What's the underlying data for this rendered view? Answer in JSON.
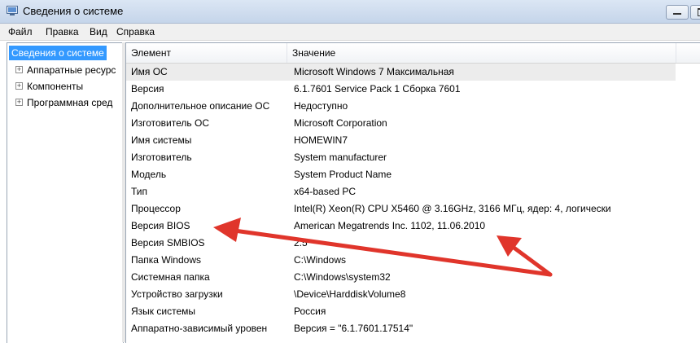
{
  "window": {
    "title": "Сведения о системе"
  },
  "menu": [
    "Файл",
    "Правка",
    "Вид",
    "Справка"
  ],
  "tree": {
    "items": [
      {
        "label": "Сведения о системе",
        "selected": true,
        "expander": ""
      },
      {
        "label": "Аппаратные ресурс",
        "expander": "+"
      },
      {
        "label": "Компоненты",
        "expander": "+"
      },
      {
        "label": "Программная сред",
        "expander": "+"
      }
    ]
  },
  "table": {
    "headers": {
      "name": "Элемент",
      "value": "Значение"
    },
    "rows": [
      {
        "name": "Имя ОС",
        "value": "Microsoft Windows 7 Максимальная"
      },
      {
        "name": "Версия",
        "value": "6.1.7601 Service Pack 1 Сборка 7601"
      },
      {
        "name": "Дополнительное описание ОС",
        "value": "Недоступно"
      },
      {
        "name": "Изготовитель ОС",
        "value": "Microsoft Corporation"
      },
      {
        "name": "Имя системы",
        "value": "HOMEWIN7"
      },
      {
        "name": "Изготовитель",
        "value": "System manufacturer"
      },
      {
        "name": "Модель",
        "value": "System Product Name"
      },
      {
        "name": "Тип",
        "value": "x64-based PC"
      },
      {
        "name": "Процессор",
        "value": "Intel(R) Xeon(R) CPU           X5460  @ 3.16GHz, 3166 МГц, ядер: 4, логически"
      },
      {
        "name": "Версия BIOS",
        "value": "American Megatrends Inc. 1102, 11.06.2010"
      },
      {
        "name": "Версия SMBIOS",
        "value": "2.5"
      },
      {
        "name": "Папка Windows",
        "value": "C:\\Windows"
      },
      {
        "name": "Системная папка",
        "value": "C:\\Windows\\system32"
      },
      {
        "name": "Устройство загрузки",
        "value": "\\Device\\HarddiskVolume8"
      },
      {
        "name": "Язык системы",
        "value": "Россия"
      },
      {
        "name": "Аппаратно-зависимый уровен",
        "value": "Версия = \"6.1.7601.17514\""
      }
    ]
  },
  "colors": {
    "selection": "#3399ff",
    "arrow": "#e0352b"
  },
  "icons": [
    "system-info-app-icon",
    "minimize-icon",
    "maximize-icon",
    "expand-plus-icon",
    "annotation-arrow-icon"
  ]
}
